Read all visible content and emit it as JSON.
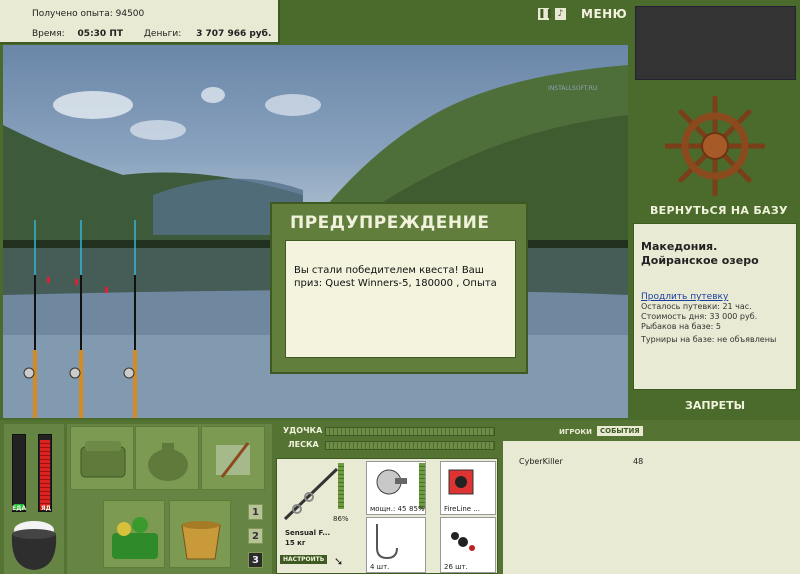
{
  "hud": {
    "exp_label": "Получено опыта:",
    "exp_value": "94500",
    "time_label": "Время:",
    "time_value": "05:30 ПТ",
    "money_label": "Деньги:",
    "money_value": "3 707 966 руб."
  },
  "topbar": {
    "pause_icon": "pause-icon",
    "sound_icon": "sound-icon",
    "menu_label": "МЕНЮ"
  },
  "scene": {
    "watermark": "INSTALLSOFT.RU"
  },
  "dialog": {
    "title": "ПРЕДУПРЕЖДЕНИЕ",
    "message": "Вы стали победителем квеста! Ваш приз: Quest Winners-5, 180000 , Опыта"
  },
  "right": {
    "return_label": "ВЕРНУТЬСЯ НА БАЗУ",
    "location_title": "Македония. Дойранское озеро",
    "extend_link": "Продлить путевку",
    "lines": [
      "Осталось путевки: 21 час.",
      "Стоимость дня: 33 000 руб.",
      "Рыбаков на базе: 5",
      "Турниры на базе: не объявлены"
    ],
    "bans_label": "ЗАПРЕТЫ"
  },
  "status": {
    "food_label": "ЕДА",
    "poison_label": "ЯД",
    "food_level": 0.08,
    "poison_level": 0.92
  },
  "inventory": {
    "pages": [
      "1",
      "2",
      "3"
    ],
    "active_page": "3"
  },
  "tackle": {
    "rod_label": "УДОЧКА",
    "line_label": "ЛЕСКА",
    "rod_percent": "86%",
    "rod_name": "Sensual F...",
    "rod_weight": "15 кг",
    "setup_label": "НАСТРОИТЬ",
    "reel_power": "мощн.: 45",
    "reel_percent": "85%",
    "line_name": "FireLine ...",
    "hook_count": "4 шт.",
    "bait_count": "26 шт."
  },
  "social": {
    "tab_players": "ИГРОКИ",
    "tab_events": "СОБЫТИЯ",
    "rows": [
      {
        "name": "CyberKiller",
        "value": "48"
      }
    ]
  },
  "colors": {
    "panel_green": "#557434",
    "cream": "#e9ead3"
  }
}
